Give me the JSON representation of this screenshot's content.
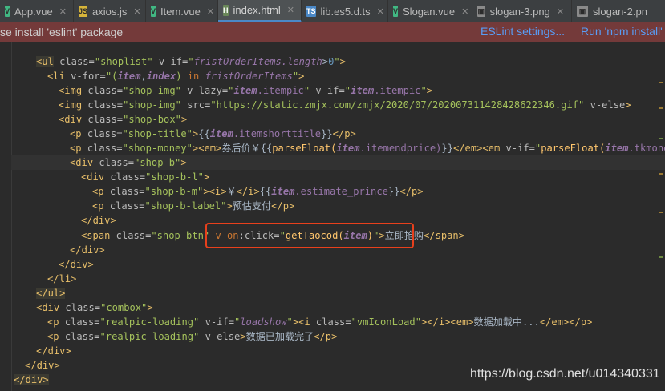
{
  "tabs": [
    {
      "label": "App.vue",
      "icon": "vue-file-icon",
      "active": false
    },
    {
      "label": "axios.js",
      "icon": "js-file-icon",
      "active": false
    },
    {
      "label": "Item.vue",
      "icon": "vue-file-icon",
      "active": false
    },
    {
      "label": "index.html",
      "icon": "html-file-icon",
      "active": true
    },
    {
      "label": "lib.es5.d.ts",
      "icon": "ts-file-icon",
      "active": false
    },
    {
      "label": "Slogan.vue",
      "icon": "vue-file-icon",
      "active": false
    },
    {
      "label": "slogan-3.png",
      "icon": "image-file-icon",
      "active": false
    },
    {
      "label": "slogan-2.pn",
      "icon": "image-file-icon",
      "active": false
    }
  ],
  "notice": {
    "message": "se install 'eslint' package",
    "settings_link": "ESLint settings...",
    "run_link": "Run 'npm install'"
  },
  "code": {
    "l1": {
      "lt": "<",
      "tag": "ul",
      "a1": " class=",
      "v1": "\"shoplist\"",
      "a2": " v-if=",
      "q1": "\"",
      "e1": "fristOrderItems.length",
      "e2": ">",
      "e3": "0",
      "q2": "\"",
      "gt": ">"
    },
    "l2": {
      "lt": "<",
      "tag": "li",
      "a1": " v-for=",
      "q1": "\"(",
      "i1": "item",
      "c1": ",",
      "i2": "index",
      "p1": ") ",
      "k1": "in",
      "e1": " fristOrderItems",
      "q2": "\"",
      "gt": ">"
    },
    "l3": {
      "lt": "<",
      "tag": "img",
      "a1": " class=",
      "v1": "\"shop-img\"",
      "a2": " v-lazy=",
      "q1": "\"",
      "i1": "item",
      "e1": ".itempic",
      "q2": "\"",
      "a3": " v-if=",
      "q3": "\"",
      "i2": "item",
      "e2": ".itempic",
      "q4": "\"",
      "gt": ">"
    },
    "l4": {
      "lt": "<",
      "tag": "img",
      "a1": " class=",
      "v1": "\"shop-img\"",
      "a2": " src=",
      "v2": "\"https://static.zmjx.com/zmjx/2020/07/20200731142842862​2346.gif\"",
      "a3": " v-else",
      "gt": ">"
    },
    "l5": {
      "lt": "<",
      "tag": "div",
      "a1": " class=",
      "v1": "\"shop-box\"",
      "gt": ">"
    },
    "l6": {
      "lt": "<",
      "tag": "p",
      "a1": " class=",
      "v1": "\"shop-title\"",
      "gt": ">",
      "o": "{{",
      "i1": "item",
      "e1": ".itemshorttitle",
      "c": "}}",
      "lt2": "</",
      "tag2": "p",
      "gt2": ">"
    },
    "l7": {
      "lt": "<",
      "tag": "p",
      "a1": " class=",
      "v1": "\"shop-money\"",
      "gt": ">",
      "lt2": "<",
      "tag2": "em",
      "gt2": ">",
      "txt": "券后价￥",
      "o": "{{",
      "e1": "parseFloat(",
      "i1": "item",
      "e2": ".itemendprice)",
      "c": "}}",
      "lt3": "</",
      "tag3": "em",
      "gt3": ">",
      "lt4": "<",
      "tag4": "em",
      "a2": " v-if=",
      "q1": "\"",
      "e3": "parseFloat(",
      "i2": "item",
      "e4": ".tkmoney)",
      "gt4": ">"
    },
    "l8": {
      "lt": "<",
      "tag": "div",
      "a1": " class=",
      "v1": "\"shop-b\"",
      "gt": ">"
    },
    "l9": {
      "lt": "<",
      "tag": "div",
      "a1": " class=",
      "v1": "\"shop-b-l\"",
      "gt": ">"
    },
    "l10": {
      "lt": "<",
      "tag": "p",
      "a1": " class=",
      "v1": "\"shop-b-m\"",
      "gt": ">",
      "lt2": "<",
      "tag2": "i",
      "gt2": ">",
      "txt": "￥",
      "lt3": "</",
      "tag3": "i",
      "gt3": ">",
      "o": "{{",
      "i1": "item",
      "e1": ".estimate_prince",
      "c": "}}",
      "lt4": "</",
      "tag4": "p",
      "gt4": ">"
    },
    "l11": {
      "lt": "<",
      "tag": "p",
      "a1": " class=",
      "v1": "\"shop-b-label\"",
      "gt": ">",
      "txt": "预估支付",
      "lt2": "</",
      "tag2": "p",
      "gt2": ">"
    },
    "l12": {
      "lt": "</",
      "tag": "div",
      "gt": ">"
    },
    "l13": {
      "lt": "<",
      "tag": "span",
      "a1": " class=",
      "v1": "\"shop-btn\"",
      "a2": " v-on",
      "a3": ":click=",
      "q1": "\"",
      "e1": "getTaocod(",
      "i1": "item",
      "e2": ")",
      "q2": "\"",
      "gt": ">",
      "txt": "立即抢购",
      "lt2": "</",
      "tag2": "span",
      "gt2": ">"
    },
    "l14": {
      "lt": "</",
      "tag": "div",
      "gt": ">"
    },
    "l15": {
      "lt": "</",
      "tag": "div",
      "gt": ">"
    },
    "l16": {
      "lt": "</",
      "tag": "li",
      "gt": ">"
    },
    "l17": {
      "lt": "</",
      "tag": "ul",
      "gt": ">"
    },
    "l18": {
      "lt": "<",
      "tag": "div",
      "a1": " class=",
      "v1": "\"combox\"",
      "gt": ">"
    },
    "l19": {
      "lt": "<",
      "tag": "p",
      "a1": " class=",
      "v1": "\"realpic-loading\"",
      "a2": " v-if=",
      "q1": "\"",
      "e1": "loadshow",
      "q2": "\"",
      "gt": ">",
      "lt2": "<",
      "tag2": "i",
      "a3": " class=",
      "v2": "\"vmIconLoad\"",
      "gt2": ">",
      "lt3": "</",
      "tag3": "i",
      "gt3": ">",
      "lt4": "<",
      "tag4": "em",
      "gt4": ">",
      "txt": "数据加载中...",
      "lt5": "</",
      "tag5": "em",
      "gt5": ">",
      "lt6": "</",
      "tag6": "p",
      "gt6": ">"
    },
    "l20": {
      "lt": "<",
      "tag": "p",
      "a1": " class=",
      "v1": "\"realpic-loading\"",
      "a2": " v-else",
      "gt": ">",
      "txt": "数据已加载完了",
      "lt2": "</",
      "tag2": "p",
      "gt2": ">"
    },
    "l21": {
      "lt": "</",
      "tag": "div",
      "gt": ">"
    },
    "l22": {
      "lt": "</",
      "tag": "div",
      "gt": ">"
    },
    "l23": {
      "lt": "</",
      "tag": "div",
      "gt": ">"
    }
  },
  "watermark": "https://blog.csdn.net/u014340331",
  "colors": {
    "accent_tab": "#4a88c7",
    "notice_bg": "#743a3a",
    "highlight": "#e8401c"
  }
}
